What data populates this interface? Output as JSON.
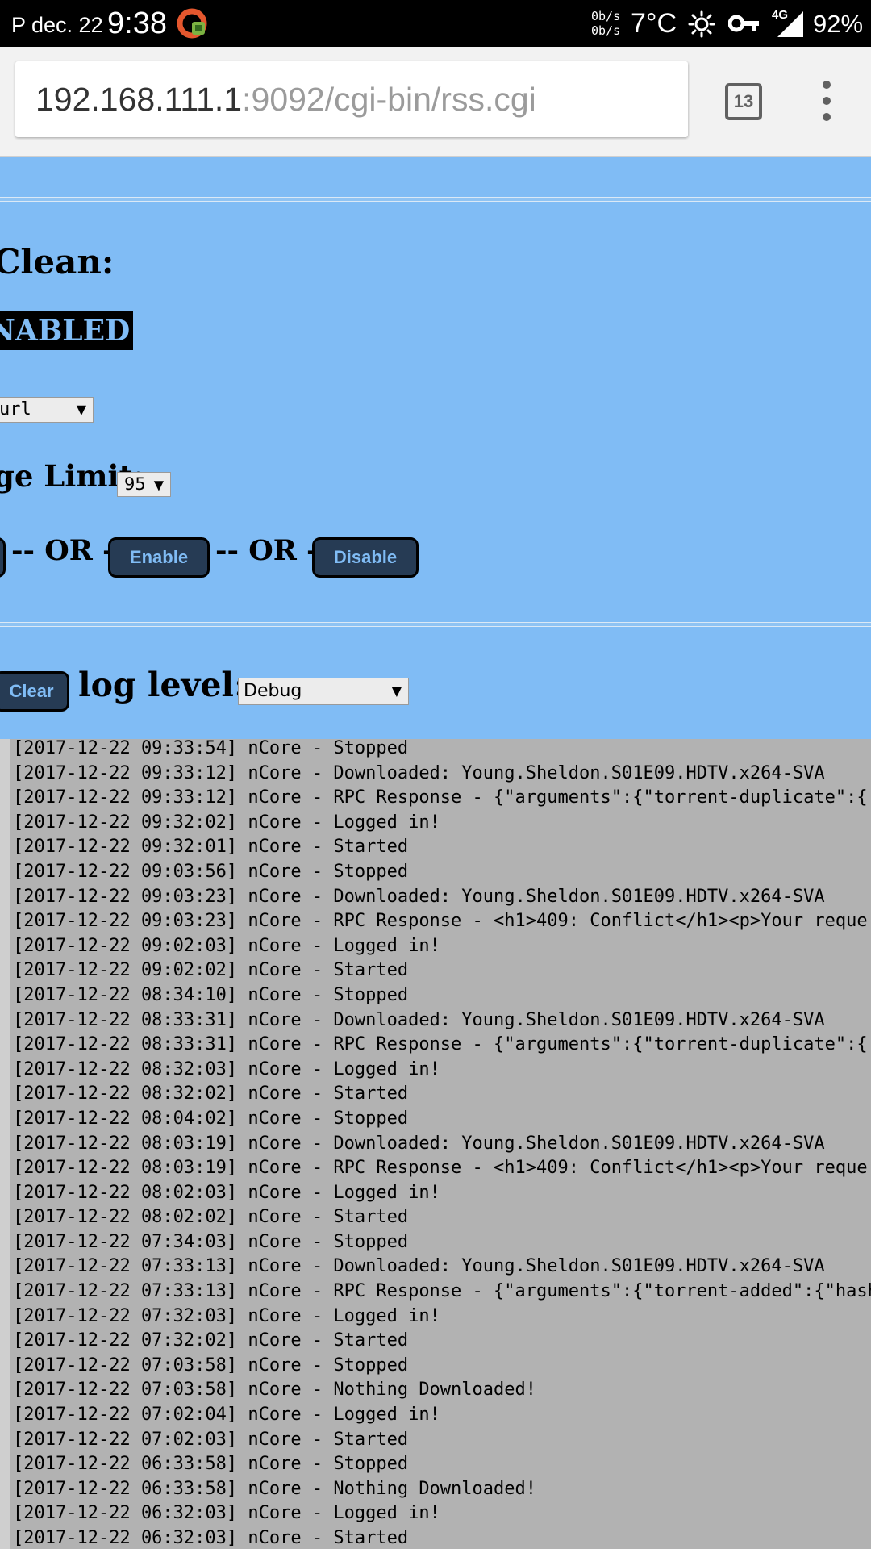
{
  "status_bar": {
    "date": "P dec. 22",
    "time": "9:38",
    "net_speed_up": "0b/s",
    "net_speed_down": "0b/s",
    "temperature": "7°C",
    "network": "4G",
    "battery": "92%",
    "icons": [
      "app-notification-icon",
      "sun-icon",
      "vpn-key-icon",
      "signal-icon"
    ]
  },
  "browser": {
    "url_host": "192.168.111.1",
    "url_path": ":9092/cgi-bin/rss.cgi",
    "tab_count": "13"
  },
  "clean_section": {
    "title": "Clean:",
    "status_badge": "NABLED",
    "method_select": "url",
    "limit_label": "ge Limit:",
    "limit_value": "95",
    "or_text_1": "-- OR --",
    "or_text_2": "-- OR --",
    "enable_label": "Enable",
    "disable_label": "Disable"
  },
  "log_section": {
    "clear_label": "Clear",
    "level_label": "log level:",
    "level_value": "Debug",
    "lines": [
      "[2017-12-22 09:33:54] nCore - Stopped",
      "[2017-12-22 09:33:12] nCore - Downloaded: Young.Sheldon.S01E09.HDTV.x264-SVA",
      "[2017-12-22 09:33:12] nCore - RPC Response - {\"arguments\":{\"torrent-duplicate\":{",
      "[2017-12-22 09:32:02] nCore - Logged in!",
      "[2017-12-22 09:32:01] nCore - Started",
      "[2017-12-22 09:03:56] nCore - Stopped",
      "[2017-12-22 09:03:23] nCore - Downloaded: Young.Sheldon.S01E09.HDTV.x264-SVA",
      "[2017-12-22 09:03:23] nCore - RPC Response - <h1>409: Conflict</h1><p>Your reque",
      "[2017-12-22 09:02:03] nCore - Logged in!",
      "[2017-12-22 09:02:02] nCore - Started",
      "[2017-12-22 08:34:10] nCore - Stopped",
      "[2017-12-22 08:33:31] nCore - Downloaded: Young.Sheldon.S01E09.HDTV.x264-SVA",
      "[2017-12-22 08:33:31] nCore - RPC Response - {\"arguments\":{\"torrent-duplicate\":{",
      "[2017-12-22 08:32:03] nCore - Logged in!",
      "[2017-12-22 08:32:02] nCore - Started",
      "[2017-12-22 08:04:02] nCore - Stopped",
      "[2017-12-22 08:03:19] nCore - Downloaded: Young.Sheldon.S01E09.HDTV.x264-SVA",
      "[2017-12-22 08:03:19] nCore - RPC Response - <h1>409: Conflict</h1><p>Your reque",
      "[2017-12-22 08:02:03] nCore - Logged in!",
      "[2017-12-22 08:02:02] nCore - Started",
      "[2017-12-22 07:34:03] nCore - Stopped",
      "[2017-12-22 07:33:13] nCore - Downloaded: Young.Sheldon.S01E09.HDTV.x264-SVA",
      "[2017-12-22 07:33:13] nCore - RPC Response - {\"arguments\":{\"torrent-added\":{\"hash",
      "[2017-12-22 07:32:03] nCore - Logged in!",
      "[2017-12-22 07:32:02] nCore - Started",
      "[2017-12-22 07:03:58] nCore - Stopped",
      "[2017-12-22 07:03:58] nCore - Nothing Downloaded!",
      "[2017-12-22 07:02:04] nCore - Logged in!",
      "[2017-12-22 07:02:03] nCore - Started",
      "[2017-12-22 06:33:58] nCore - Stopped",
      "[2017-12-22 06:33:58] nCore - Nothing Downloaded!",
      "[2017-12-22 06:32:03] nCore - Logged in!",
      "[2017-12-22 06:32:03] nCore - Started"
    ]
  },
  "colors": {
    "page_bg": "#80BCF5",
    "button_bg": "#263B54",
    "log_bg": "#B2B2B2"
  }
}
